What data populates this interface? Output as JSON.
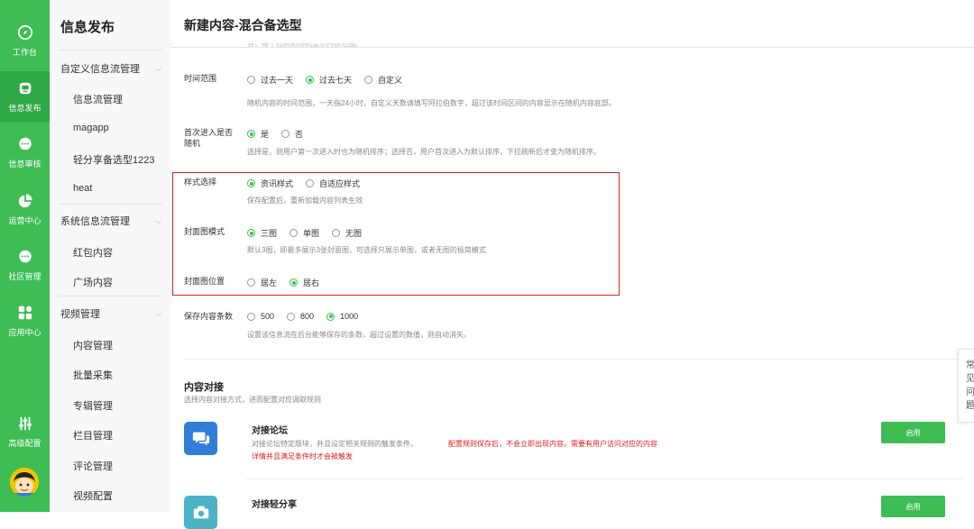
{
  "rail": {
    "items": [
      {
        "label": "工作台",
        "icon": "compass-icon"
      },
      {
        "label": "信息发布",
        "icon": "publish-icon"
      },
      {
        "label": "信息审核",
        "icon": "chat-review-icon"
      },
      {
        "label": "运营中心",
        "icon": "pie-chart-icon"
      },
      {
        "label": "社区管理",
        "icon": "community-icon"
      },
      {
        "label": "应用中心",
        "icon": "apps-grid-icon"
      },
      {
        "label": "高级配置",
        "icon": "sliders-icon"
      }
    ],
    "active_index": 1,
    "color": "#3dbd54"
  },
  "sidebar": {
    "title": "信息发布",
    "groups": [
      {
        "label": "自定义信息流管理",
        "items": [
          "信息流管理",
          "magapp",
          "轻分享备选型1223",
          "heat"
        ]
      },
      {
        "label": "系统信息流管理",
        "items": [
          "红包内容",
          "广场内容"
        ]
      },
      {
        "label": "视频管理",
        "items": [
          "内容管理",
          "批量采集",
          "专辑管理",
          "栏目管理",
          "评论管理",
          "视频配置"
        ]
      }
    ]
  },
  "page": {
    "title": "新建内容-混合备选型",
    "clipped_hint": "容，每十拉刷新随机显示内容范围。"
  },
  "form": {
    "time_range": {
      "label": "时间范围",
      "options": [
        "过去一天",
        "过去七天",
        "自定义"
      ],
      "selected": "过去七天",
      "help": "随机内容的时间范围，一天指24小时，自定义天数请填写阿拉伯数字，超过该时间区间的内容显示在随机内容底部。"
    },
    "first_random": {
      "label": "首次进入是否随机",
      "options": [
        "是",
        "否"
      ],
      "selected": "是",
      "help": "选择是，则用户第一次进入时也为随机排序；选择否，用户首次进入为默认排序，下拉刷新后才变为随机排序。"
    },
    "style": {
      "label": "样式选择",
      "options": [
        "资讯样式",
        "自适应样式"
      ],
      "selected": "资讯样式",
      "help": "保存配置后，重新加载内容列表生效"
    },
    "cover_mode": {
      "label": "封面图模式",
      "options": [
        "三图",
        "单图",
        "无图"
      ],
      "selected": "三图",
      "help": "默认3图，即最多展示3张封面图，可选择只展示单图，或者无图的极简模式"
    },
    "cover_position": {
      "label": "封面图位置",
      "options": [
        "居左",
        "居右"
      ],
      "selected": "居右"
    },
    "save_count": {
      "label": "保存内容条数",
      "options": [
        "500",
        "800",
        "1000"
      ],
      "selected": "1000",
      "help": "设置该信息流在后台能够保存的条数，超过设置的数值，则自动消失。"
    }
  },
  "content_section": {
    "title": "内容对接",
    "subtitle": "选择内容对接方式，进而配置对应调取规则",
    "cards": [
      {
        "title": "对接论坛",
        "desc": "对接论坛特定版块，并且设定相关规则的触发条件。",
        "warning": "配置规则保存后，不会立即出现内容。需要有用户访问对应的内容",
        "warning2": "详情并且满足条件时才会被触发",
        "button": "启用",
        "icon": "chat-bubbles-icon"
      },
      {
        "title": "对接轻分享",
        "button": "启用",
        "icon": "camera-icon"
      }
    ]
  },
  "float_help": "常见问题",
  "colors": {
    "accent": "#3dbd54",
    "warning": "#e02020",
    "card_icon": "#2f7fd8",
    "card_icon2": "#4bb3c4"
  }
}
